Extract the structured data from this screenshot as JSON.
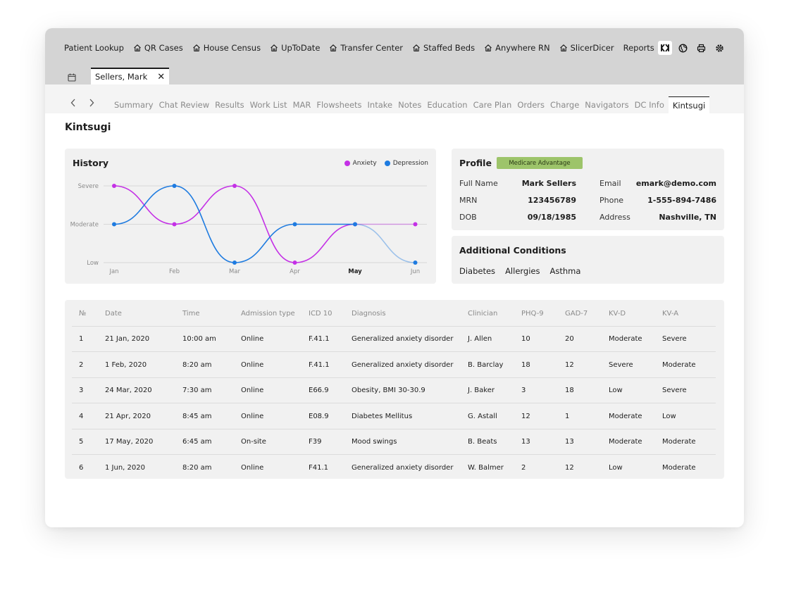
{
  "toolbar": {
    "items": [
      {
        "label": "Patient Lookup",
        "icon": "none"
      },
      {
        "label": "QR Cases",
        "icon": "home-icon"
      },
      {
        "label": "House Census",
        "icon": "home-icon"
      },
      {
        "label": "UpToDate",
        "icon": "home-icon"
      },
      {
        "label": "Transfer Center",
        "icon": "home-icon"
      },
      {
        "label": "Staffed Beds",
        "icon": "home-icon"
      },
      {
        "label": "Anywhere RN",
        "icon": "home-icon"
      },
      {
        "label": "SlicerDicer",
        "icon": "home-icon"
      }
    ],
    "reports_label": "Reports",
    "right_icons": [
      "kintsugi-logo-icon",
      "globe-icon",
      "print-icon",
      "gear-icon"
    ]
  },
  "patient_tab": {
    "label": "Sellers, Mark"
  },
  "nav": {
    "tabs": [
      "Summary",
      "Chat Review",
      "Results",
      "Work List",
      "MAR",
      "Flowsheets",
      "Intake",
      "Notes",
      "Education",
      "Care Plan",
      "Orders",
      "Charge",
      "Navigators",
      "DC Info",
      "Kintsugi"
    ],
    "active": "Kintsugi"
  },
  "page_title": "Kintsugi",
  "history": {
    "title": "History",
    "colors": {
      "anxiety": "#c430e6",
      "depression": "#1e7be0"
    }
  },
  "chart_data": {
    "type": "line",
    "categories": [
      "Jan",
      "Feb",
      "Mar",
      "Apr",
      "May",
      "Jun"
    ],
    "highlight_category": "May",
    "y_levels": [
      "Low",
      "Moderate",
      "Severe"
    ],
    "ylim": [
      0,
      2
    ],
    "grid": true,
    "legend_position": "top-right",
    "series": [
      {
        "name": "Anxiety",
        "values": [
          2,
          1,
          2,
          0,
          1,
          1
        ],
        "color": "#c430e6"
      },
      {
        "name": "Depression",
        "values": [
          1,
          2,
          0,
          1,
          1,
          0
        ],
        "color": "#1e7be0"
      }
    ]
  },
  "profile": {
    "title": "Profile",
    "badge": "Medicare Advantage",
    "badge_color": "#9dc46a",
    "fields": [
      {
        "label": "Full Name",
        "value": "Mark Sellers"
      },
      {
        "label": "MRN",
        "value": "123456789"
      },
      {
        "label": "DOB",
        "value": "09/18/1985"
      },
      {
        "label": "Email",
        "value": "emark@demo.com"
      },
      {
        "label": "Phone",
        "value": "1-555-894-7486"
      },
      {
        "label": "Address",
        "value": "Nashville, TN"
      }
    ]
  },
  "conditions": {
    "title": "Additional Conditions",
    "items": [
      "Diabetes",
      "Allergies",
      "Asthma"
    ]
  },
  "table": {
    "headers": [
      "№",
      "Date",
      "Time",
      "Admission type",
      "ICD 10",
      "Diagnosis",
      "Clinician",
      "PHQ-9",
      "GAD-7",
      "KV-D",
      "KV-A"
    ],
    "rows": [
      [
        "1",
        "21 Jan, 2020",
        "10:00 am",
        "Online",
        "F.41.1",
        "Generalized anxiety disorder",
        "J. Allen",
        "10",
        "20",
        "Moderate",
        "Severe"
      ],
      [
        "2",
        "1 Feb, 2020",
        "8:20 am",
        "Online",
        "F.41.1",
        "Generalized anxiety disorder",
        "B. Barclay",
        "18",
        "12",
        "Severe",
        "Moderate"
      ],
      [
        "3",
        "24 Mar, 2020",
        "7:30 am",
        "Online",
        "E66.9",
        "Obesity, BMI 30-30.9",
        "J. Baker",
        "3",
        "18",
        "Low",
        "Severe"
      ],
      [
        "4",
        "21 Apr, 2020",
        "8:45 am",
        "Online",
        "E08.9",
        "Diabetes Mellitus",
        "G. Astall",
        "12",
        "1",
        "Moderate",
        "Low"
      ],
      [
        "5",
        "17 May, 2020",
        "6:45 am",
        "On-site",
        "F39",
        "Mood swings",
        "B. Beats",
        "13",
        "13",
        "Moderate",
        "Moderate"
      ],
      [
        "6",
        "1 Jun, 2020",
        "8:20 am",
        "Online",
        "F41.1",
        "Generalized anxiety disorder",
        "W. Balmer",
        "2",
        "12",
        "Low",
        "Moderate"
      ]
    ]
  }
}
